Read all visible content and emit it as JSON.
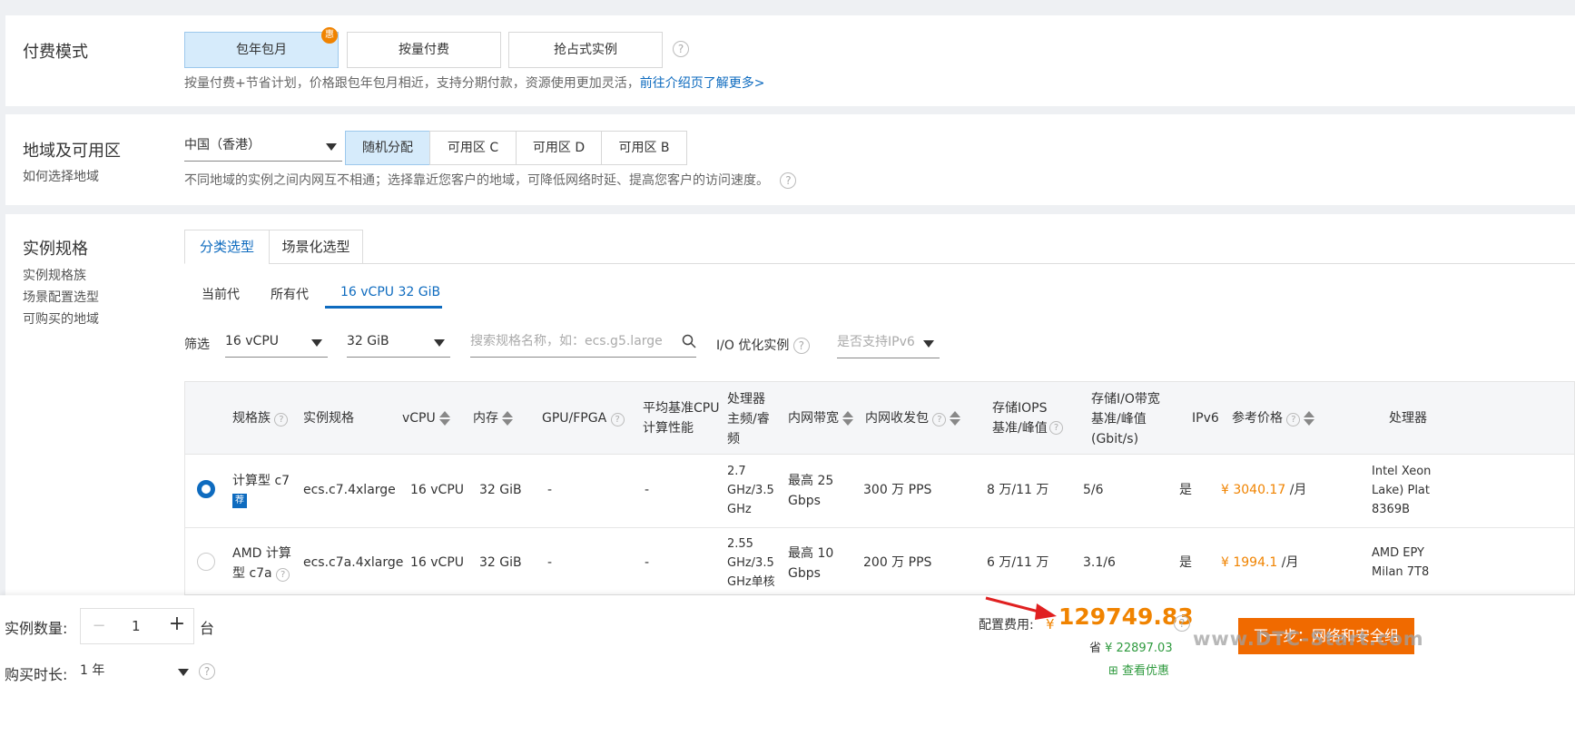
{
  "billing": {
    "title": "付费模式",
    "options": [
      "包年包月",
      "按量付费",
      "抢占式实例"
    ],
    "promo_badge": "惠",
    "hint": "按量付费+节省计划，价格跟包年包月相近，支持分期付款，资源使用更加灵活，",
    "hint_link": "前往介绍页了解更多>"
  },
  "region": {
    "title": "地域及可用区",
    "subtitle": "如何选择地域",
    "selected": "中国（香港）",
    "zones": [
      "随机分配",
      "可用区 C",
      "可用区 D",
      "可用区 B"
    ],
    "hint": "不同地域的实例之间内网互不相通；选择靠近您客户的地域，可降低网络时延、提高您客户的访问速度。"
  },
  "spec": {
    "title": "实例规格",
    "side_links": [
      "实例规格族",
      "场景配置选型",
      "可购买的地域"
    ],
    "tabs": [
      "分类选型",
      "场景化选型"
    ],
    "subtabs": [
      "当前代",
      "所有代",
      "16 vCPU 32 GiB"
    ],
    "filter": {
      "label": "筛选",
      "vcpu": "16 vCPU",
      "memory": "32 GiB",
      "search_placeholder": "搜索规格名称，如：ecs.g5.large",
      "io_label": "I/O 优化实例",
      "ipv6_placeholder": "是否支持IPv6"
    },
    "columns": [
      "规格族",
      "实例规格",
      "vCPU",
      "内存",
      "GPU/FPGA",
      "平均基准CPU\n计算性能",
      "处理器\n主频/睿\n频",
      "内网带宽",
      "内网收发包",
      "存储IOPS\n基准/峰值",
      "存储I/O带宽\n基准/峰值\n(Gbit/s)",
      "IPv6",
      "参考价格",
      "处理器"
    ],
    "rows": [
      {
        "family": "计算型 c7",
        "badge": "荐",
        "spec": "ecs.c7.4xlarge",
        "vcpu": "16 vCPU",
        "memory": "32 GiB",
        "gpu": "-",
        "cpu_perf": "-",
        "freq": "2.7\nGHz/3.5\nGHz",
        "bandwidth": "最高 25\nGbps",
        "pps": "300 万 PPS",
        "iops": "8 万/11 万",
        "io_bw": "5/6",
        "ipv6": "是",
        "price": "¥ 3040.17",
        "price_unit": " /月",
        "processor": "Intel Xeon\nLake) Plat\n8369B",
        "selected": true
      },
      {
        "family": "AMD 计算\n型 c7a",
        "badge": "",
        "spec": "ecs.c7a.4xlarge",
        "vcpu": "16 vCPU",
        "memory": "32 GiB",
        "gpu": "-",
        "cpu_perf": "-",
        "freq": "2.55\nGHz/3.5\nGHz单核",
        "bandwidth": "最高 10\nGbps",
        "pps": "200 万 PPS",
        "iops": "6 万/11 万",
        "io_bw": "3.1/6",
        "ipv6": "是",
        "price": "¥ 1994.1",
        "price_unit": " /月",
        "processor": "AMD EPY\nMilan 7T8",
        "selected": false
      }
    ]
  },
  "footer": {
    "qty_label": "实例数量:",
    "qty_value": "1",
    "qty_unit": "台",
    "duration_label": "购买时长:",
    "duration_value": "1 年",
    "cost_label": "配置费用:",
    "cost_currency": "¥",
    "cost_value": "129749.83",
    "save_label": "省",
    "save_value": "¥ 22897.03",
    "discount_link": "查看优惠",
    "next_button": "下一步：网络和安全组",
    "watermark": "www.DTC-Start.com"
  },
  "colors": {
    "accent": "#0e6bbf",
    "price": "#f08300",
    "next_button": "#f06a00"
  }
}
